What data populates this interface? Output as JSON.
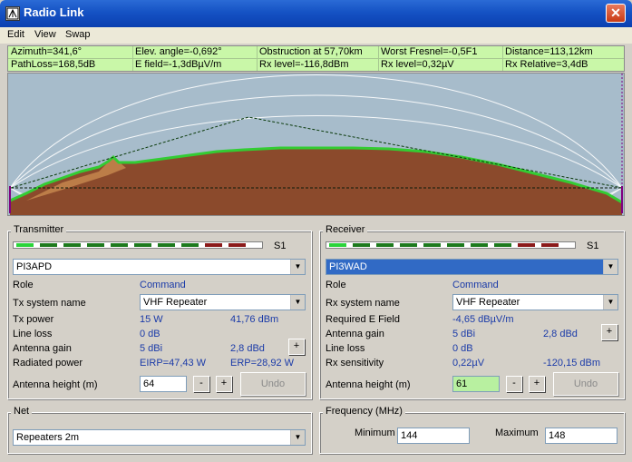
{
  "window": {
    "title": "Radio Link",
    "close_icon": "close-icon"
  },
  "menu": [
    "Edit",
    "View",
    "Swap"
  ],
  "info": {
    "row1": [
      "Azimuth=341,6°",
      "Elev. angle=-0,692°",
      "Obstruction at 57,70km",
      "Worst Fresnel=-0,5F1",
      "Distance=113,12km"
    ],
    "row2": [
      "PathLoss=168,5dB",
      "E field=-1,3dBµV/m",
      "Rx level=-116,8dBm",
      "Rx level=0,32µV",
      "Rx Relative=3,4dB"
    ]
  },
  "colors": {
    "info_bg": "#c9f7a8",
    "terrain": "#8b4a2c",
    "terrain_edge": "#33cc33",
    "sky": "#a7bccb",
    "accent": "#1a3aa8"
  },
  "transmitter": {
    "title": "Transmitter",
    "meter_label": "S1",
    "station": "PI3APD",
    "role_label": "Role",
    "role_value": "Command",
    "system_label": "Tx system name",
    "system_value": "VHF Repeater",
    "power_label": "Tx power",
    "power_w": "15 W",
    "power_dbm": "41,76 dBm",
    "lineloss_label": "Line loss",
    "lineloss_value": "0 dB",
    "gain_label": "Antenna gain",
    "gain_dbi": "5 dBi",
    "gain_dbd": "2,8 dBd",
    "radiated_label": "Radiated power",
    "eirp": "EIRP=47,43 W",
    "erp": "ERP=28,92 W",
    "height_label": "Antenna height (m)",
    "height_value": "64",
    "minus": "-",
    "plus": "+",
    "undo": "Undo"
  },
  "receiver": {
    "title": "Receiver",
    "meter_label": "S1",
    "station": "PI3WAD",
    "role_label": "Role",
    "role_value": "Command",
    "system_label": "Rx system name",
    "system_value": "VHF Repeater",
    "efield_label": "Required E Field",
    "efield_value": "-4,65 dBµV/m",
    "gain_label": "Antenna gain",
    "gain_dbi": "5 dBi",
    "gain_dbd": "2,8 dBd",
    "lineloss_label": "Line loss",
    "lineloss_value": "0 dB",
    "sens_label": "Rx sensitivity",
    "sens_uv": "0,22µV",
    "sens_dbm": "-120,15 dBm",
    "height_label": "Antenna height (m)",
    "height_value": "61",
    "minus": "-",
    "plus": "+",
    "undo": "Undo"
  },
  "net": {
    "title": "Net",
    "value": "Repeaters 2m"
  },
  "frequency": {
    "title": "Frequency (MHz)",
    "min_label": "Minimum",
    "min_value": "144",
    "max_label": "Maximum",
    "max_value": "148"
  }
}
